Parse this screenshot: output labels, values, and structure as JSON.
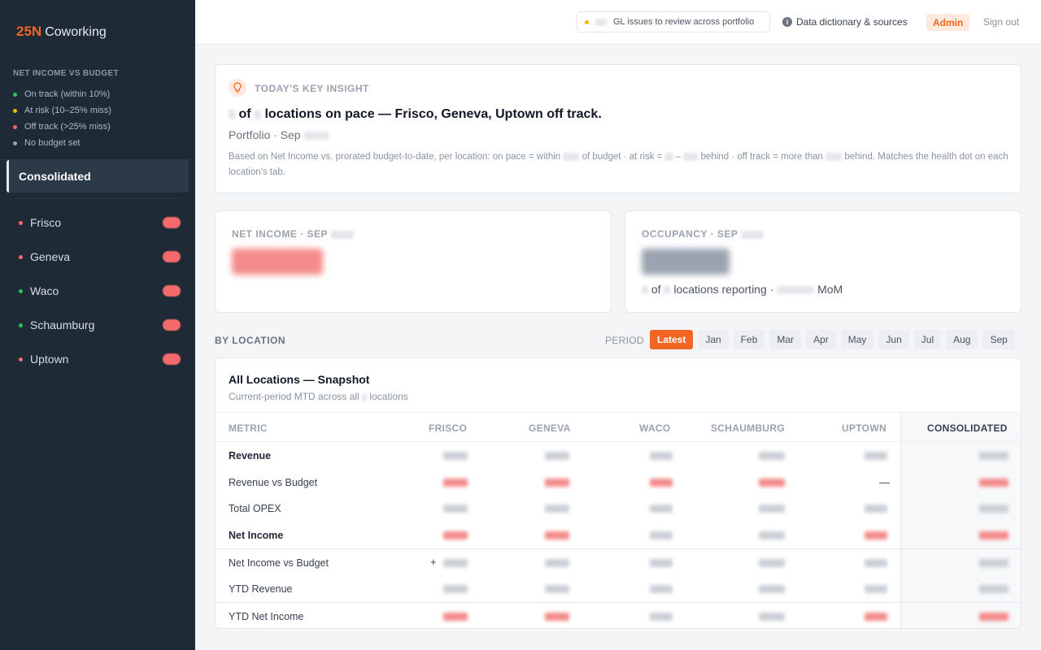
{
  "brand": {
    "mark": "25N",
    "name": "Coworking"
  },
  "sidebar": {
    "legend_title": "NET INCOME VS BUDGET",
    "legend": [
      {
        "label": "On track (within 10%)",
        "color": "#22c55e"
      },
      {
        "label": "At risk (10–25% miss)",
        "color": "#f5b700"
      },
      {
        "label": "Off track (>25% miss)",
        "color": "#f46a6a"
      },
      {
        "label": "No budget set",
        "color": "#9aa3af"
      }
    ],
    "active": "Consolidated",
    "locations": [
      {
        "label": "Frisco",
        "color": "#f46a6a"
      },
      {
        "label": "Geneva",
        "color": "#f46a6a"
      },
      {
        "label": "Waco",
        "color": "#22c55e"
      },
      {
        "label": "Schaumburg",
        "color": "#22c55e"
      },
      {
        "label": "Uptown",
        "color": "#f46a6a"
      }
    ]
  },
  "topbar": {
    "gl_text": "GL issues to review across portfolio",
    "gl_dot_color": "#f5b700",
    "dictionary": "Data dictionary & sources",
    "admin": "Admin",
    "signout": "Sign out"
  },
  "insight": {
    "label": "TODAY'S KEY INSIGHT",
    "of": "of",
    "headline": "locations on pace — Frisco, Geneva, Uptown off track.",
    "sub": "Portfolio · Sep",
    "desc_a": "Based on Net Income vs. prorated budget-to-date, per location: on pace = within",
    "desc_b": "of budget · at risk =",
    "desc_c": "behind · off track = more than",
    "desc_d": "behind. Matches the health dot on each location's tab."
  },
  "kpis": {
    "net_income_label": "NET INCOME · SEP",
    "occupancy_label": "OCCUPANCY · SEP",
    "occ_of": "of",
    "occ_reporting": "locations reporting ·",
    "occ_mom": "MoM"
  },
  "by_location": {
    "title": "BY LOCATION",
    "period_label": "PERIOD",
    "periods": [
      "Latest",
      "Jan",
      "Feb",
      "Mar",
      "Apr",
      "May",
      "Jun",
      "Jul",
      "Aug",
      "Sep"
    ],
    "active_period": "Latest"
  },
  "table": {
    "title": "All Locations — Snapshot",
    "sub_a": "Current-period MTD across all",
    "sub_b": "locations",
    "headers": [
      "METRIC",
      "FRISCO",
      "GENEVA",
      "WACO",
      "SCHAUMBURG",
      "UPTOWN",
      "CONSOLIDATED"
    ],
    "rows": [
      {
        "metric": "Revenue",
        "bold": true
      },
      {
        "metric": "Revenue vs Budget",
        "bold": false,
        "uptown_dash": "—"
      },
      {
        "metric": "Total OPEX",
        "bold": false
      },
      {
        "metric": "Net Income",
        "bold": true
      },
      {
        "metric": "Net Income vs Budget",
        "bold": false,
        "frisco_plus": "+"
      },
      {
        "metric": "YTD Revenue",
        "bold": false
      },
      {
        "metric": "YTD Net Income",
        "bold": false
      }
    ],
    "colors": {
      "neutral": "#cbd0d6",
      "negative": "#f48b8b"
    }
  }
}
